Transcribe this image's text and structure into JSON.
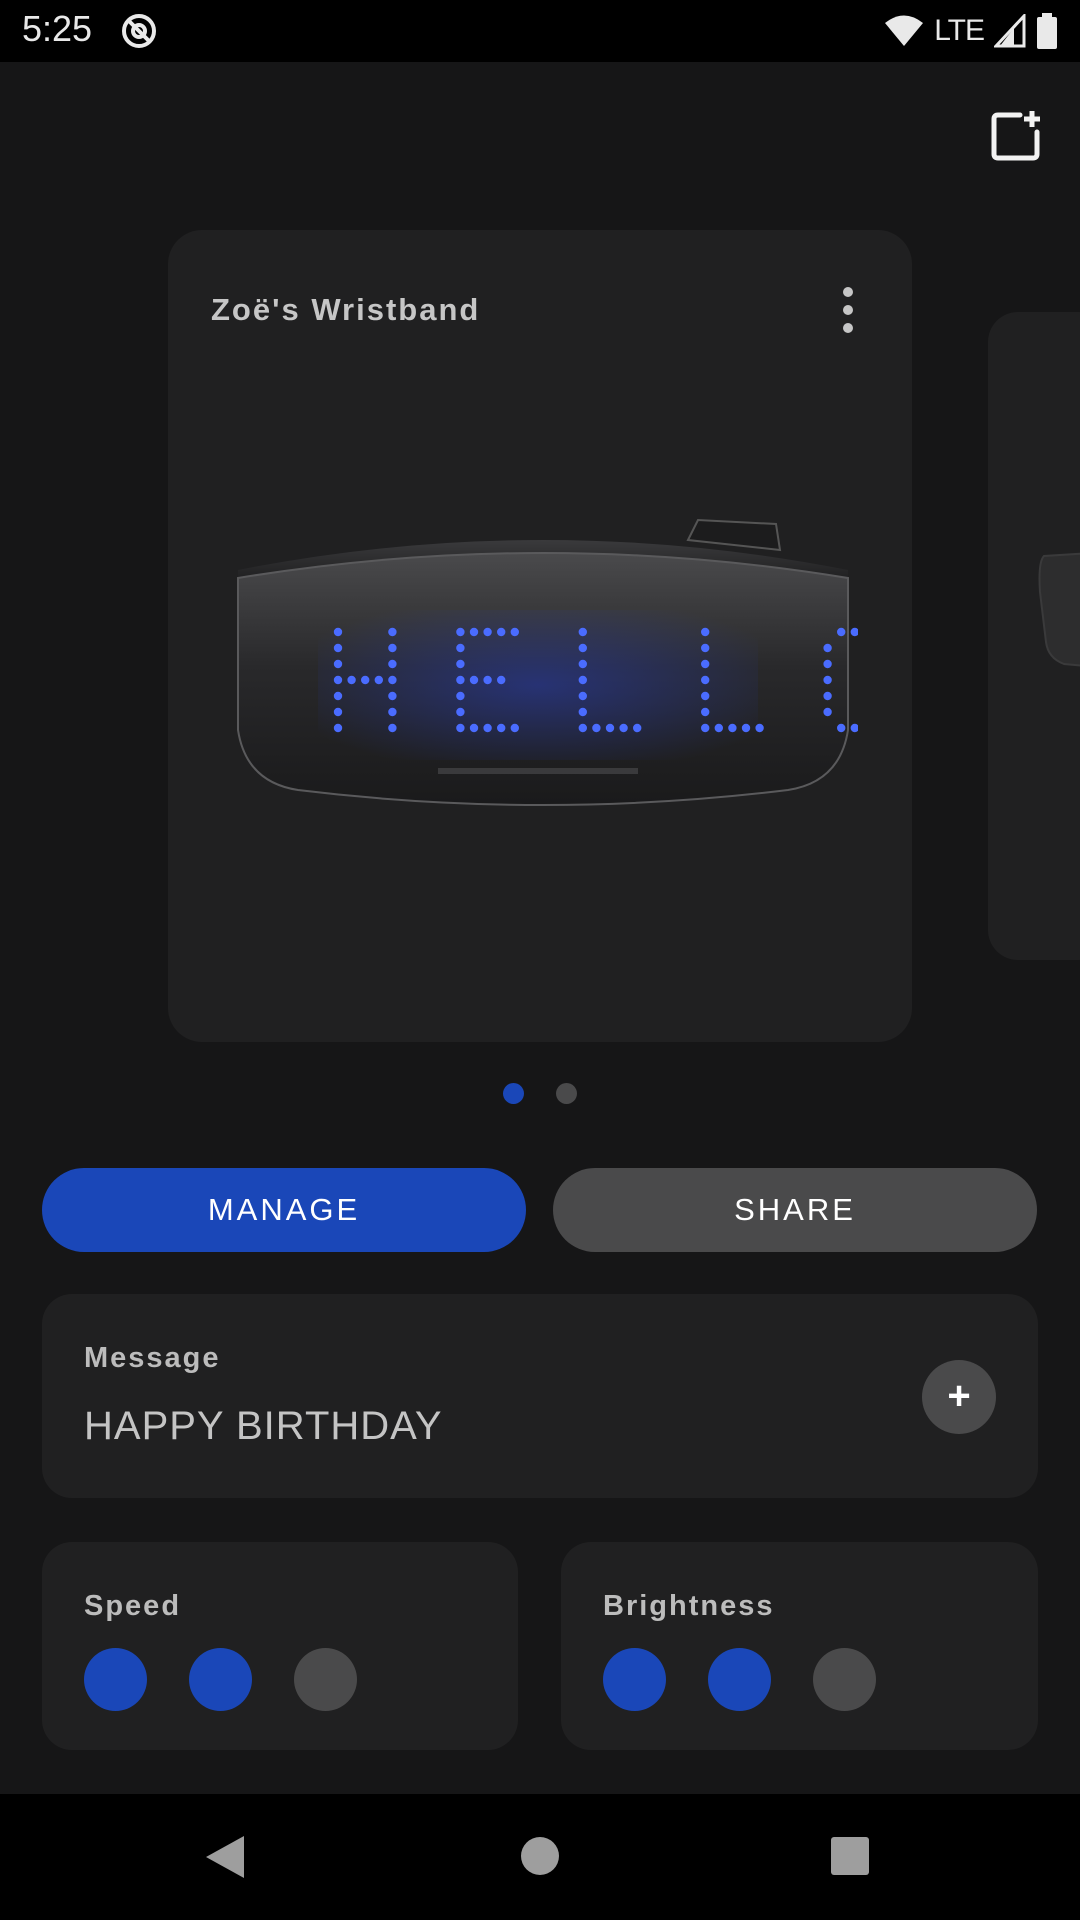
{
  "status_bar": {
    "time": "5:25",
    "network": "LTE",
    "icons": [
      "assistant-icon",
      "wifi-icon",
      "signal-icon",
      "battery-icon"
    ]
  },
  "toolbar": {
    "add_icon": "add-device-icon"
  },
  "device_card": {
    "title": "Zoë's Wristband",
    "menu_icon": "more-vert-icon",
    "display_text": "HELLO"
  },
  "pager": {
    "page_count": 2,
    "current_page": 1,
    "active_color": "#1a47b8",
    "inactive_color": "#4a4a4b"
  },
  "actions": {
    "manage_label": "MANAGE",
    "share_label": "SHARE"
  },
  "message": {
    "label": "Message",
    "value": "HAPPY BIRTHDAY",
    "add_icon": "plus-icon"
  },
  "speed": {
    "label": "Speed",
    "level": 2,
    "max": 3
  },
  "brightness": {
    "label": "Brightness",
    "level": 2,
    "max": 3
  },
  "colors": {
    "accent": "#1a47b8",
    "background": "#161617",
    "card": "#202021",
    "secondary_button": "#4a4a4b"
  },
  "nav": {
    "back_icon": "back-icon",
    "home_icon": "home-icon",
    "recents_icon": "recents-icon"
  }
}
